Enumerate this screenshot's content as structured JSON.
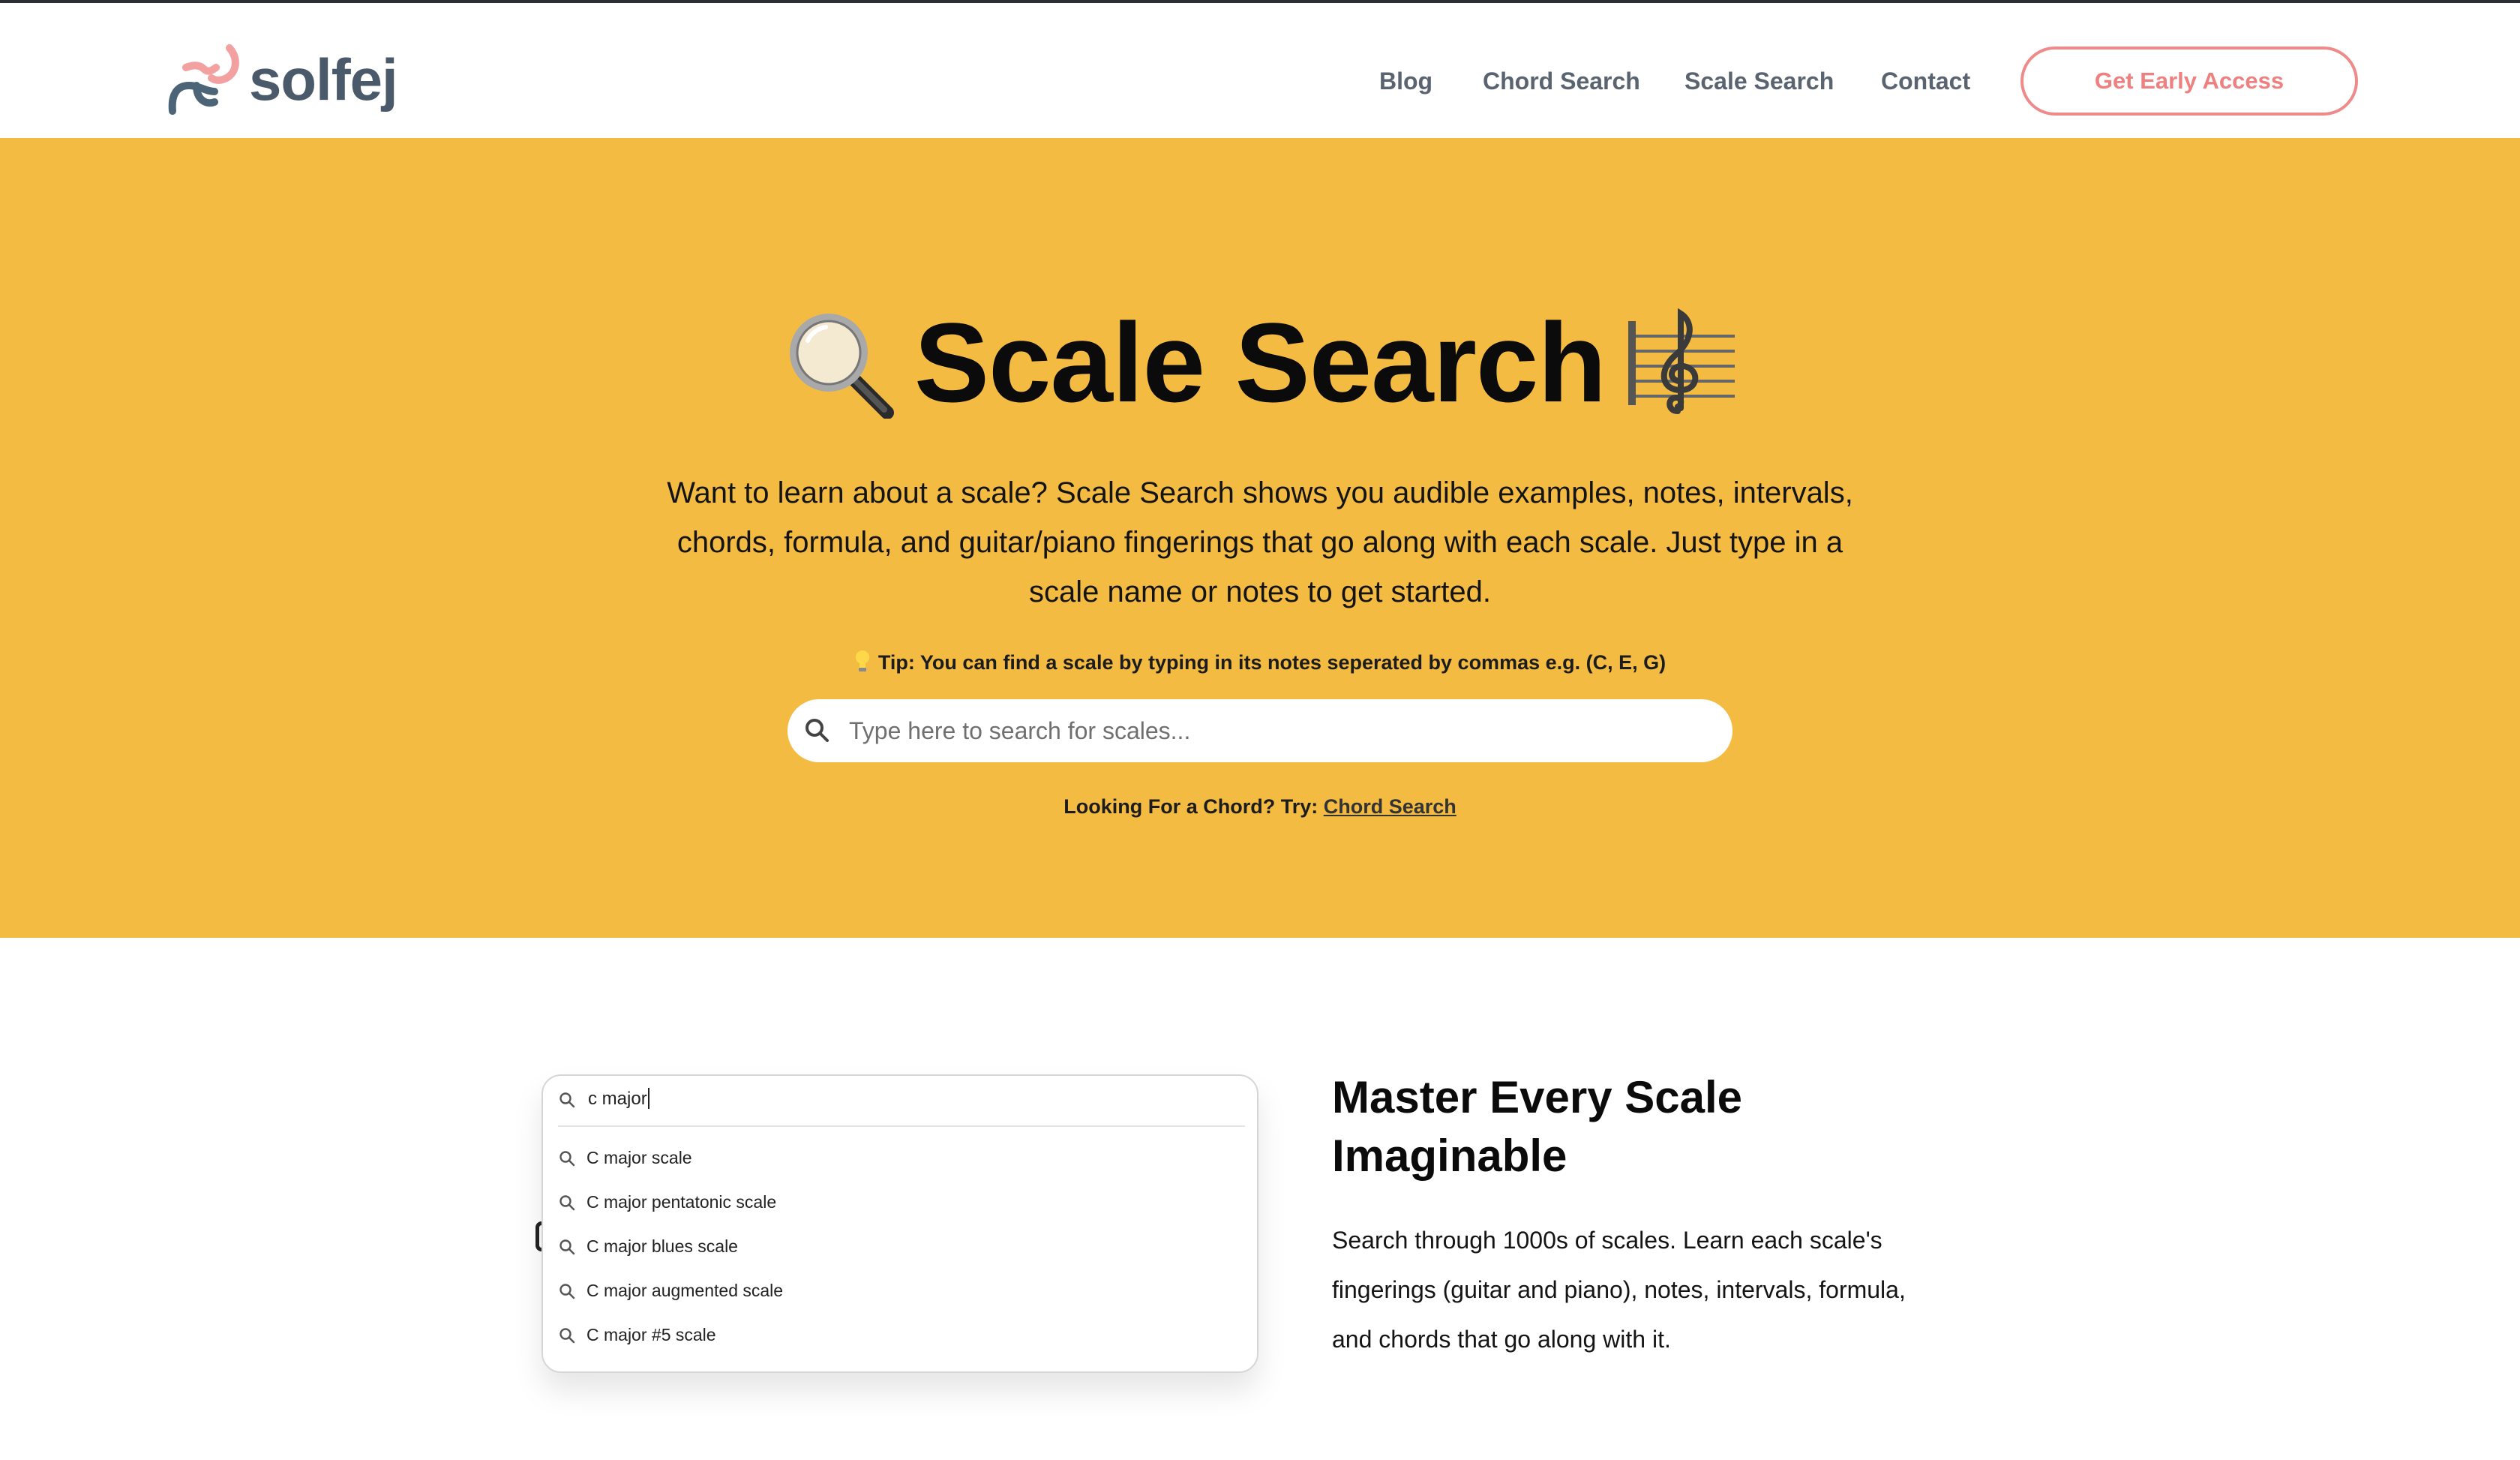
{
  "brand": {
    "name": "solfej",
    "colors": {
      "accent": "#ee8080",
      "hero_bg": "#f4bb43",
      "logo_text": "#4a5a6a",
      "logo_pink": "#f2a0a0",
      "logo_slate": "#4b6478"
    }
  },
  "nav": {
    "items": [
      {
        "label": "Blog"
      },
      {
        "label": "Chord Search"
      },
      {
        "label": "Scale Search"
      },
      {
        "label": "Contact"
      }
    ],
    "cta_label": "Get Early Access"
  },
  "hero": {
    "title": "Scale Search",
    "title_icons": [
      "magnifying-glass-icon",
      "musical-score-icon"
    ],
    "description": "Want to learn about a scale? Scale Search shows you audible examples, notes, intervals, chords, formula, and guitar/piano fingerings that go along with each scale. Just type in a scale name or notes to get started.",
    "tip": "Tip: You can find a scale by typing in its notes seperated by commas e.g. (C, E, G)",
    "search": {
      "placeholder": "Type here to search for scales...",
      "value": ""
    },
    "alt_prefix": "Looking For a Chord? Try:",
    "alt_link": "Chord Search"
  },
  "feature": {
    "demo": {
      "query": "c major",
      "suggestions": [
        "C major scale",
        "C major pentatonic scale",
        "C major blues scale",
        "C major augmented scale",
        "C major #5 scale"
      ]
    },
    "title": "Master Every Scale Imaginable",
    "description": "Search through 1000s of scales. Learn each scale's fingerings (guitar and piano), notes, intervals, formula, and chords that go along with it."
  }
}
